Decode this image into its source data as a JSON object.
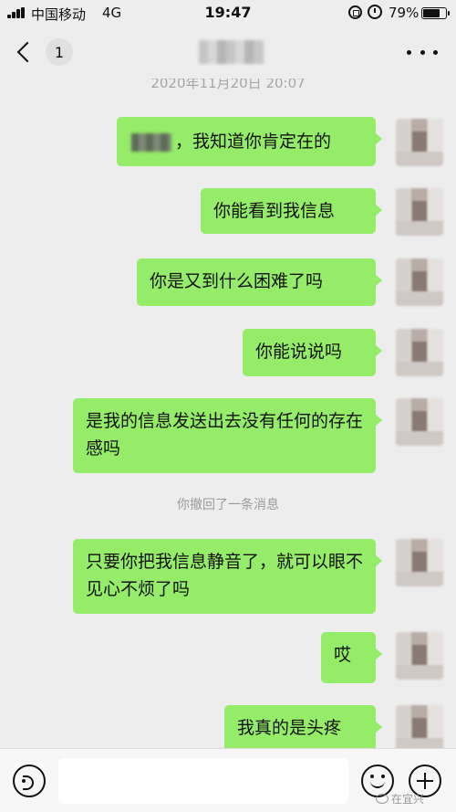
{
  "status_bar": {
    "carrier": "中国移动",
    "network": "4G",
    "time": "19:47",
    "battery_percent": "79%",
    "battery_level": 0.79
  },
  "nav": {
    "badge_count": "1"
  },
  "chat": {
    "timestamp": "2020年11月20日 20:07",
    "messages": [
      {
        "text": "，我知道你肯定在的"
      },
      {
        "text": "你能看到我信息"
      },
      {
        "text": "你是又到什么困难了吗"
      },
      {
        "text": "你能说说吗"
      },
      {
        "text": "是我的信息发送出去没有任何的存在感吗"
      },
      {
        "text": "只要你把我信息静音了，就可以眼不见心不烦了吗"
      },
      {
        "text": "哎"
      },
      {
        "text": "我真的是头疼"
      }
    ],
    "recall_notice": "你撤回了一条消息"
  },
  "input_bar": {
    "placeholder": ""
  },
  "watermark": "在宜兴"
}
